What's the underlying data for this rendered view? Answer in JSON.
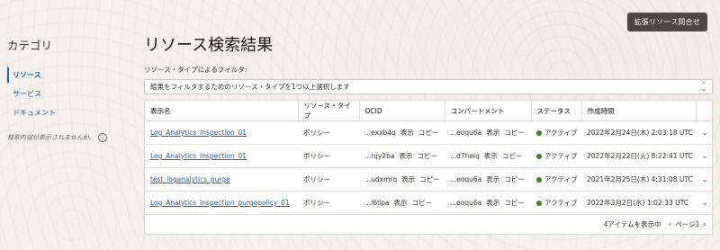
{
  "header": {
    "advanced_button": "拡張リソース問合せ"
  },
  "sidebar": {
    "title": "カテゴリ",
    "items": [
      {
        "label": "リソース",
        "active": true
      },
      {
        "label": "サービス",
        "active": false
      },
      {
        "label": "ドキュメント",
        "active": false
      }
    ],
    "note": "検索内容が表示されませんか。",
    "note_icon": "i"
  },
  "main": {
    "title": "リソース検索結果",
    "filter_label": "リソース・タイプによるフィルタ:",
    "filter_placeholder": "結果をフィルタするためのリソース・タイプを1つ以上選択します",
    "columns": [
      "表示名",
      "リソース・タイプ",
      "OCID",
      "コンパートメント",
      "ステータス",
      "作成時間"
    ],
    "action_show": "表示",
    "action_copy": "コピー",
    "rows": [
      {
        "name": "Log_Analytics_Inspection_01",
        "type": "ポリシー",
        "ocid": "...exxb4q",
        "compartment": "...eoqu6a",
        "status": "アクティブ",
        "created": "2022年2月24日(木) 2:03:18 UTC"
      },
      {
        "name": "Log_Analytics_Inspection_01",
        "type": "ポリシー",
        "ocid": "...rqy2ba",
        "compartment": "...d7heiq",
        "status": "アクティブ",
        "created": "2022年2月22日(火) 8:22:41 UTC"
      },
      {
        "name": "test_loganalytics_purge",
        "type": "ポリシー",
        "ocid": "...udxmrq",
        "compartment": "...eoqu6a",
        "status": "アクティブ",
        "created": "2021年2月25日(木) 4:31:08 UTC"
      },
      {
        "name": "Log_Analytics_Inspection_purgepolicy_01",
        "type": "ポリシー",
        "ocid": "...l6llpa",
        "compartment": "...eoqu6a",
        "status": "アクティブ",
        "created": "2022年3月2日(水) 1:02:33 UTC"
      }
    ],
    "footer": {
      "count_text": "4アイテムを表示中",
      "page_text": "ページ1"
    }
  },
  "colors": {
    "link": "#2f5f94",
    "status_active": "#4d7b2b",
    "button_bg": "#4a4744"
  }
}
